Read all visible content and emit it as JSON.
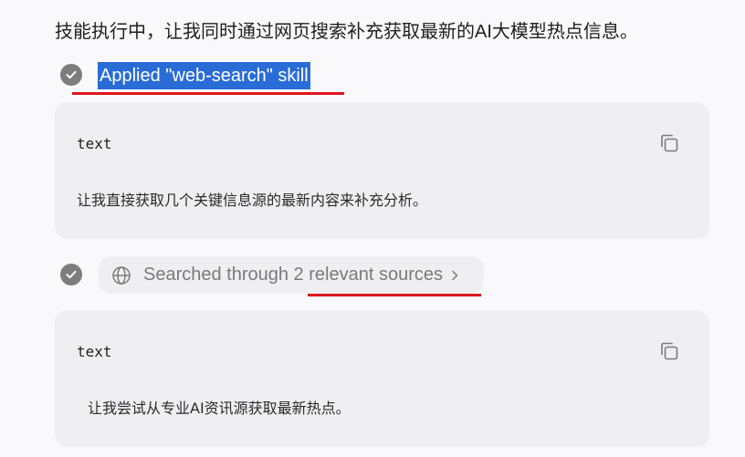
{
  "intro_text": "技能执行中，让我同时通过网页搜索补充获取最新的AI大模型热点信息。",
  "skill_step": {
    "label": "Applied \"web-search\" skill",
    "icon": "check-circle-icon"
  },
  "code_blocks": [
    {
      "language": "text",
      "content": "让我直接获取几个关键信息源的最新内容来补充分析。",
      "copy_icon": "copy-icon"
    },
    {
      "language": "text",
      "content": "让我尝试从专业AI资讯源获取最新热点。",
      "copy_icon": "copy-icon"
    }
  ],
  "search_step": {
    "label": "Searched through 2 relevant sources",
    "icon": "globe-icon",
    "chevron": "chevron-right-icon"
  },
  "colors": {
    "highlight": "#2a6cd6",
    "annotation_underline": "#e0141e",
    "card_bg": "#efeff1",
    "check_bg": "#7d7d7d"
  }
}
